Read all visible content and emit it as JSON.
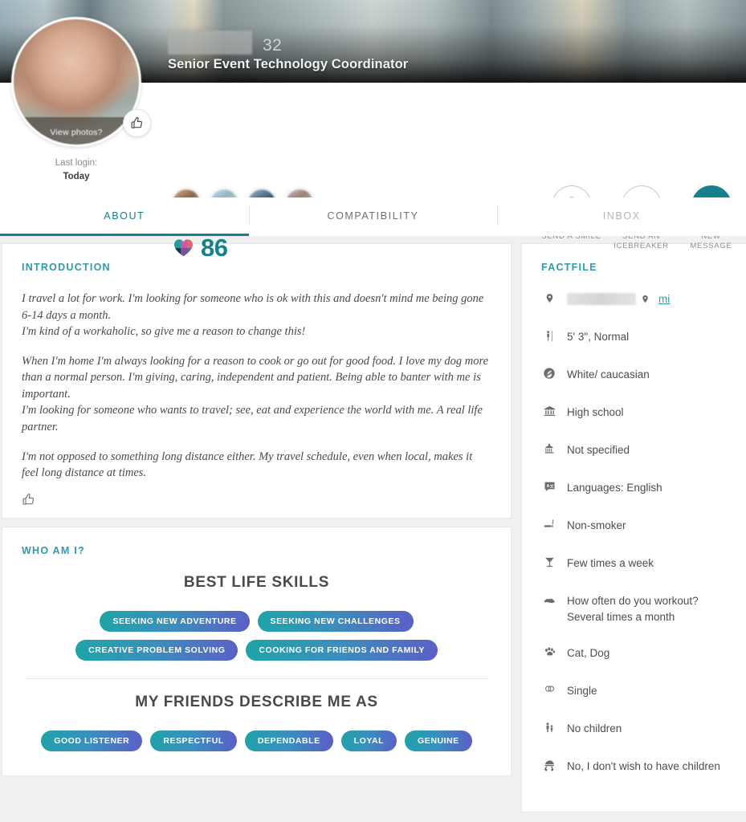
{
  "banner": {
    "name_redacted": "",
    "age": "32",
    "headline": "Senior Event Technology Coordinator"
  },
  "profile": {
    "view_photos_label": "View photos?",
    "last_login_label": "Last login:",
    "last_login_value": "Today",
    "like_icon": "thumbs-up-icon",
    "match_score": "86",
    "match_icon": "multicolor-heart-icon",
    "thumbnails": [
      {
        "name": "photo-thumbnail-1"
      },
      {
        "name": "photo-thumbnail-2"
      },
      {
        "name": "photo-thumbnail-3"
      },
      {
        "name": "photo-thumbnail-4"
      }
    ]
  },
  "actions": [
    {
      "label": "SEND A SMILE",
      "icon": "smiley-face-icon",
      "filled": false
    },
    {
      "label": "SEND AN ICEBREAKER",
      "icon": "heart-card-icon",
      "filled": false
    },
    {
      "label": "NEW MESSAGE",
      "icon": "chat-bubble-icon",
      "filled": true
    }
  ],
  "tabs": [
    {
      "label": "ABOUT",
      "state": "active"
    },
    {
      "label": "COMPATIBILITY",
      "state": "default"
    },
    {
      "label": "INBOX",
      "state": "muted"
    }
  ],
  "introduction": {
    "title": "INTRODUCTION",
    "paragraphs": [
      "I travel a lot for work. I'm looking for someone who is ok with this and doesn't mind me being gone 6-14 days a month.\nI'm kind of a workaholic, so give me a reason to change this!",
      "When I'm home I'm always looking for a reason to cook or go out for good food. I love my dog more than a normal person. I'm giving, caring, independent and patient. Being able to banter with me is important.\nI'm looking for someone who wants to travel; see, eat and experience the world with me. A real life partner.",
      "I'm not opposed to something long distance either. My travel schedule, even when local, makes it feel long distance at times."
    ],
    "like_icon": "thumbs-up-icon"
  },
  "who_am_i": {
    "title": "WHO AM I?",
    "sections": [
      {
        "heading": "BEST LIFE SKILLS",
        "pills": [
          "SEEKING NEW ADVENTURE",
          "SEEKING NEW CHALLENGES",
          "CREATIVE PROBLEM SOLVING",
          "COOKING FOR FRIENDS AND FAMILY"
        ]
      },
      {
        "heading": "MY FRIENDS DESCRIBE ME AS",
        "pills": [
          "GOOD LISTENER",
          "RESPECTFUL",
          "DEPENDABLE",
          "LOYAL",
          "GENUINE"
        ]
      }
    ]
  },
  "factfile": {
    "title": "FACTFILE",
    "location": {
      "icon": "location-pin-icon",
      "value_redacted": "",
      "distance_icon": "location-pin-icon",
      "distance_label": "mi"
    },
    "items": [
      {
        "icon": "body-height-icon",
        "text": "5' 3\", Normal"
      },
      {
        "icon": "globe-icon",
        "text": "White/ caucasian"
      },
      {
        "icon": "bank-building-icon",
        "text": "High school"
      },
      {
        "icon": "government-icon",
        "text": "Not specified"
      },
      {
        "icon": "language-icon",
        "text": "Languages: English"
      },
      {
        "icon": "cigarette-icon",
        "text": "Non-smoker"
      },
      {
        "icon": "cocktail-glass-icon",
        "text": "Few times a week"
      },
      {
        "icon": "sneaker-icon",
        "text": "How often do you workout? Several times a month"
      },
      {
        "icon": "paw-print-icon",
        "text": "Cat, Dog"
      },
      {
        "icon": "rings-icon",
        "text": "Single"
      },
      {
        "icon": "family-icon",
        "text": "No children"
      },
      {
        "icon": "stroller-icon",
        "text": "No, I don't wish to have children"
      }
    ]
  },
  "colors": {
    "teal": "#17808d",
    "teal_light": "#2e9aab",
    "pill_gradient_start": "#1fa3a8",
    "pill_gradient_end": "#5b5fc7",
    "page_background": "#f0f0f0"
  }
}
